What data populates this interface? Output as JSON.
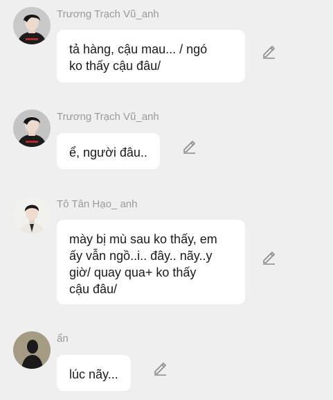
{
  "messages": [
    {
      "sender": "Trương Trạch Vũ_anh",
      "text": "tả hàng, cậu mau... / ngó\nko thấy cậu đâu/",
      "avatar_icon": "boy-portrait-black-hoodie",
      "edit_icon": "pencil-icon"
    },
    {
      "sender": "Trương Trạch Vũ_anh",
      "text": "ể, người đâu..",
      "avatar_icon": "boy-portrait-black-hoodie",
      "edit_icon": "pencil-icon"
    },
    {
      "sender": "Tô Tân Hạo_ anh",
      "text": "mày bị mù sau ko thấy, em\nấy vẫn ngồ..i.. đây.. nãy..y\ngiờ/ quay qua+ ko thấy\ncậu đâu/",
      "avatar_icon": "boy-portrait-white-shirt",
      "edit_icon": "pencil-icon"
    },
    {
      "sender": "ẩn",
      "text": "lúc nãy...",
      "avatar_icon": "silhouette-portrait",
      "edit_icon": "pencil-icon"
    }
  ],
  "colors": {
    "background": "#efefef",
    "bubble": "#ffffff",
    "sender_text": "#9a9a9a",
    "message_text": "#1a1a1a",
    "icon": "#8a8a8a"
  }
}
